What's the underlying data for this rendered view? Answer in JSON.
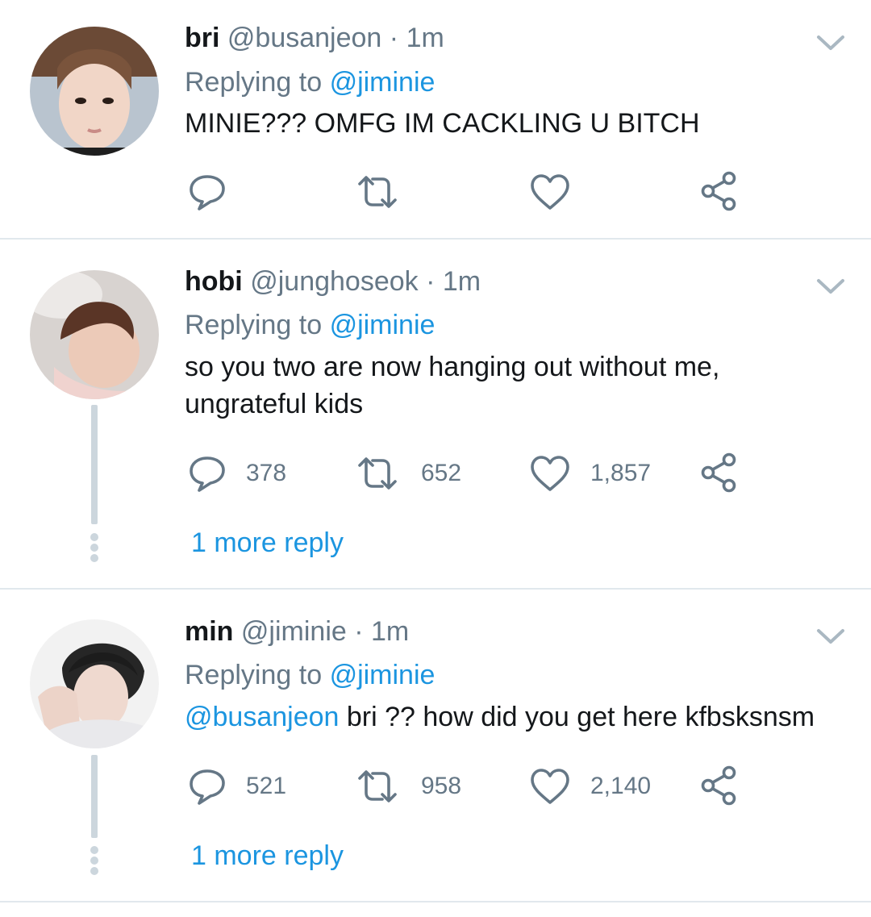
{
  "tweets": [
    {
      "name": "bri",
      "handle": "@busanjeon",
      "time": "· 1m",
      "replying_prefix": "Replying to",
      "replying_handle": "@jiminie",
      "mention": "",
      "text": "MINIE??? OMFG IM CACKLING U BITCH",
      "reply_count": "",
      "retweet_count": "",
      "like_count": "",
      "more_reply": ""
    },
    {
      "name": "hobi",
      "handle": "@junghoseok",
      "time": "· 1m",
      "replying_prefix": "Replying to",
      "replying_handle": "@jiminie",
      "mention": "",
      "text": "so you two are now hanging out without me, ungrateful kids",
      "reply_count": "378",
      "retweet_count": "652",
      "like_count": "1,857",
      "more_reply": "1 more reply"
    },
    {
      "name": "min",
      "handle": "@jiminie",
      "time": "· 1m",
      "replying_prefix": "Replying to",
      "replying_handle": "@jiminie",
      "mention": "@busanjeon",
      "text": " bri ?? how did you get here kfbsksnsm",
      "reply_count": "521",
      "retweet_count": "958",
      "like_count": "2,140",
      "more_reply": "1 more reply"
    }
  ],
  "icons": {
    "reply": "reply-icon",
    "retweet": "retweet-icon",
    "like": "heart-icon",
    "share": "share-icon",
    "menu": "chevron-down-icon"
  },
  "colors": {
    "link": "#1b95e0",
    "secondary_text": "#657786",
    "icon": "#657786",
    "thread_line": "#ccd6dd",
    "divider": "#e1e8ed"
  }
}
